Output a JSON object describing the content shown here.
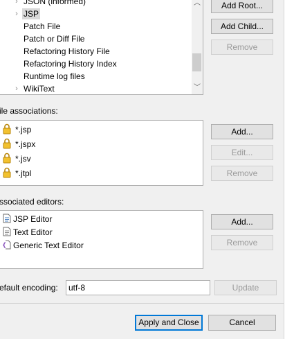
{
  "tree": {
    "items": [
      {
        "label": "JSON (informed)",
        "expandable": true
      },
      {
        "label": "JSP",
        "expandable": true,
        "selected": true
      },
      {
        "label": "Patch File",
        "expandable": false
      },
      {
        "label": "Patch or Diff File",
        "expandable": false
      },
      {
        "label": "Refactoring History File",
        "expandable": false
      },
      {
        "label": "Refactoring History Index",
        "expandable": false
      },
      {
        "label": "Runtime log files",
        "expandable": false
      },
      {
        "label": "WikiText",
        "expandable": true
      }
    ]
  },
  "tree_buttons": {
    "add_root": "Add Root...",
    "add_child": "Add Child...",
    "remove": "Remove"
  },
  "file_assoc": {
    "label": "ile associations:",
    "items": [
      "*.jsp",
      "*.jspx",
      "*.jsv",
      "*.jtpl"
    ],
    "add": "Add...",
    "edit": "Edit...",
    "remove": "Remove"
  },
  "editors": {
    "label": "ssociated editors:",
    "items": [
      {
        "label": "JSP Editor",
        "icon": "jsp-editor-icon"
      },
      {
        "label": "Text Editor",
        "icon": "text-editor-icon"
      },
      {
        "label": "Generic Text Editor",
        "icon": "generic-text-editor-icon"
      }
    ],
    "add": "Add...",
    "remove": "Remove"
  },
  "encoding": {
    "label": "efault encoding:",
    "value": "utf-8",
    "update": "Update"
  },
  "footer": {
    "apply_close": "Apply and Close",
    "cancel": "Cancel"
  }
}
